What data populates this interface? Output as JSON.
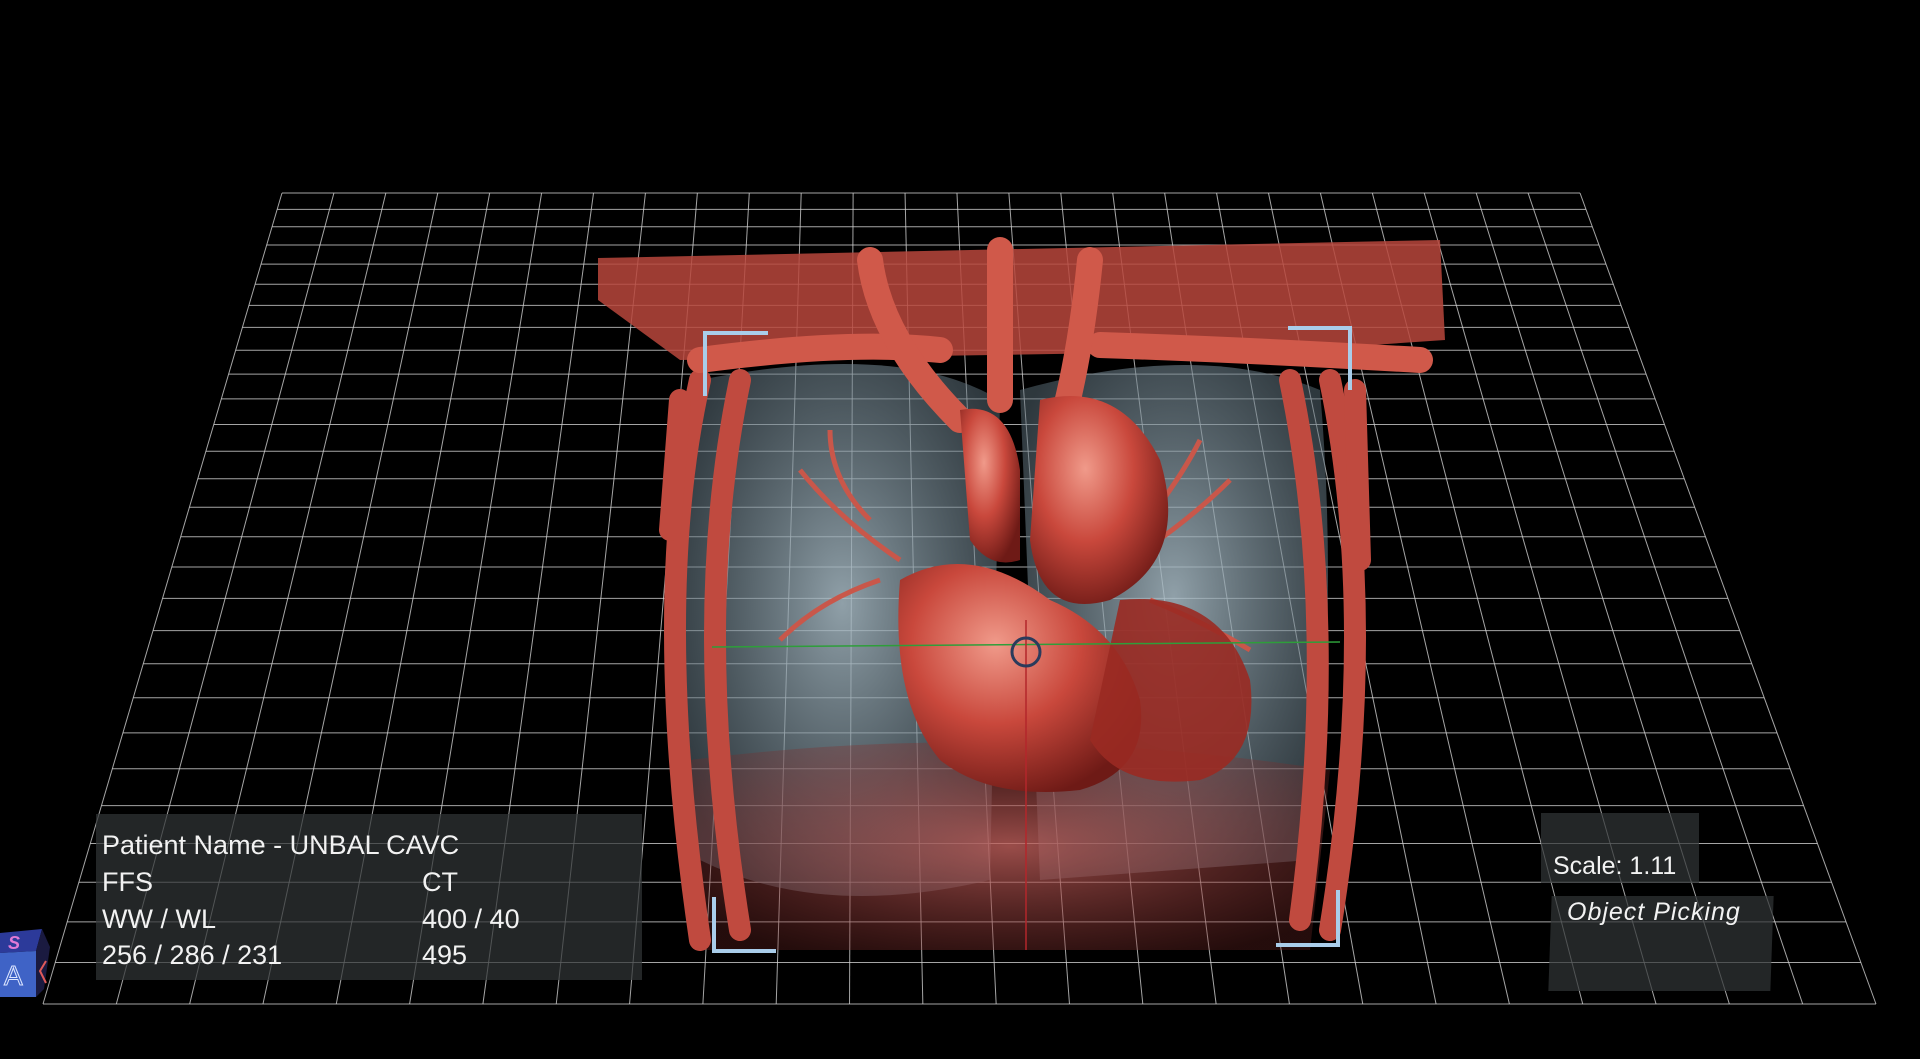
{
  "viewer": {
    "mode": "3D Volume Rendering",
    "colors": {
      "background": "#000000",
      "grid": "#cfcfcf",
      "tissue": "#c8473c",
      "lung": "#8fa6b3",
      "bracket": "#a9cdea",
      "crosshair_h": "#2e9e3a",
      "crosshair_v": "#b3262b"
    }
  },
  "info_panel": {
    "patient_name": "Patient Name - UNBAL CAVC",
    "position": "FFS",
    "modality": "CT",
    "window_label": "WW / WL",
    "window_value": "400 / 40",
    "dimensions": "256 / 286 / 231",
    "slice_count": "495"
  },
  "scale_panel": {
    "scale": "Scale: 1.11"
  },
  "mode_panel": {
    "label": "Object Picking"
  },
  "orientation_cube": {
    "top": "S",
    "front": "A"
  }
}
